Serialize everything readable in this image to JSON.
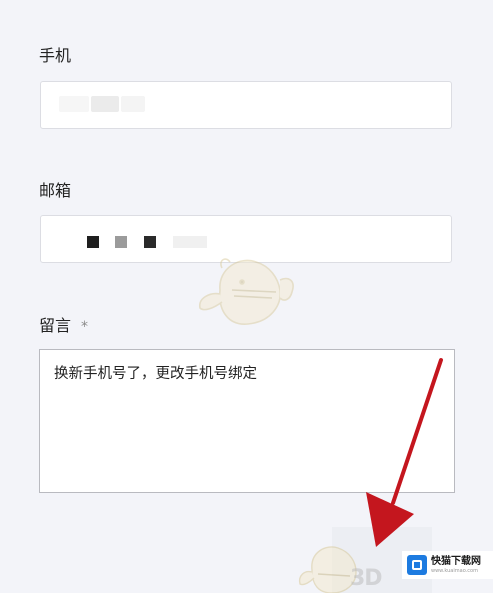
{
  "form": {
    "phone": {
      "label": "手机"
    },
    "email": {
      "label": "邮箱"
    },
    "message": {
      "label": "留言",
      "required_mark": "*",
      "value": "换新手机号了，更改手机号绑定"
    }
  },
  "watermark": {
    "brand_name": "快猫下载网",
    "brand_url": "www.kuaimao.com",
    "corner_text": "3D"
  },
  "icons": {
    "arrow": "red-arrow-annotation",
    "mascot": "mascot-watermark",
    "brand_logo": "brand-logo-icon"
  },
  "colors": {
    "background": "#f3f4f9",
    "arrow": "#c4161e",
    "brand_blue": "#1d7be0"
  }
}
